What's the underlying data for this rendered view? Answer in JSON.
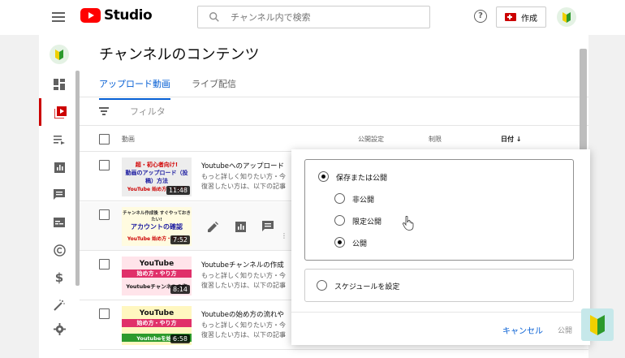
{
  "header": {
    "logo_text": "Studio",
    "search_placeholder": "チャンネル内で検索",
    "help_symbol": "?",
    "create_label": "作成"
  },
  "main": {
    "page_title": "チャンネルのコンテンツ",
    "tabs": [
      {
        "label": "アップロード動画",
        "active": true
      },
      {
        "label": "ライブ配信",
        "active": false
      }
    ],
    "filter_label": "フィルタ",
    "columns": {
      "video": "動画",
      "visibility": "公開設定",
      "restriction": "制限",
      "date": "日付 ↓"
    },
    "rows": [
      {
        "thumb_line1": "超・初心者向け!",
        "thumb_line2": "動画のアップロード（投稿）方法",
        "thumb_line3": "YouTube 始め方・やり方",
        "duration": "11:48",
        "title": "Youtubeへのアップロード",
        "desc1": "もっと詳しく知りたい方・今",
        "desc2": "復習したい方は、以下の記事"
      },
      {
        "thumb_line1": "チャンネル作成後 すぐやっておきたい!",
        "thumb_line2": "アカウントの確認",
        "thumb_line3": "YouTube 始め方・やり方",
        "duration": "7:52",
        "title": "",
        "desc1": "",
        "desc2": ""
      },
      {
        "thumb_line1": "YouTube",
        "thumb_line2": "始め方・やり方",
        "thumb_line3": "Youtubeチャンネルの作",
        "duration": "8:14",
        "title": "Youtubeチャンネルの作成",
        "desc1": "もっと詳しく知りたい方・今",
        "desc2": "復習したい方は、以下の記事"
      },
      {
        "thumb_line1": "YouTube",
        "thumb_line2": "始め方・やり方",
        "thumb_line3": "Youtubeを始め",
        "duration": "6:58",
        "title": "Youtubeの始め方の流れや",
        "desc1": "もっと詳しく知りたい方・今",
        "desc2": "復習したい方は、以下の記事"
      }
    ]
  },
  "popup": {
    "save_or_publish": "保存または公開",
    "options": [
      {
        "label": "非公開",
        "checked": false
      },
      {
        "label": "限定公開",
        "checked": false
      },
      {
        "label": "公開",
        "checked": true
      }
    ],
    "schedule_label": "スケジュールを設定",
    "cancel_label": "キャンセル",
    "publish_label": "公開"
  },
  "colors": {
    "accent_blue": "#065fd4",
    "youtube_red": "#ff0000"
  }
}
